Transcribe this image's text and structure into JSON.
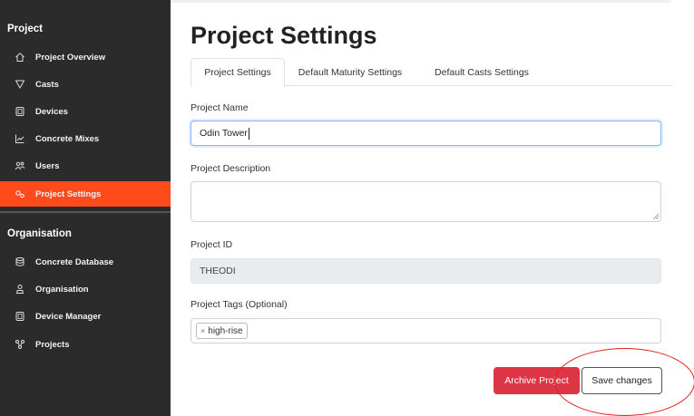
{
  "sidebar": {
    "project_section": "Project",
    "organisation_section": "Organisation",
    "project_items": [
      {
        "label": "Project Overview",
        "icon": "home-icon"
      },
      {
        "label": "Casts",
        "icon": "filter-icon"
      },
      {
        "label": "Devices",
        "icon": "device-icon"
      },
      {
        "label": "Concrete Mixes",
        "icon": "chart-line-icon"
      },
      {
        "label": "Users",
        "icon": "users-icon"
      },
      {
        "label": "Project Settings",
        "icon": "settings-icon",
        "active": true
      }
    ],
    "organisation_items": [
      {
        "label": "Concrete Database",
        "icon": "database-icon"
      },
      {
        "label": "Organisation",
        "icon": "organisation-icon"
      },
      {
        "label": "Device Manager",
        "icon": "device-icon"
      },
      {
        "label": "Projects",
        "icon": "projects-icon"
      }
    ]
  },
  "main": {
    "title": "Project Settings",
    "tabs": [
      {
        "label": "Project Settings",
        "active": true
      },
      {
        "label": "Default Maturity Settings"
      },
      {
        "label": "Default Casts Settings"
      }
    ],
    "fields": {
      "project_name_label": "Project Name",
      "project_name_value": "Odin Tower",
      "project_description_label": "Project Description",
      "project_description_value": "",
      "project_id_label": "Project ID",
      "project_id_value": "THEODI",
      "project_tags_label": "Project Tags (Optional)",
      "tags": [
        "high-rise"
      ],
      "tag_remove_glyph": "×"
    },
    "buttons": {
      "archive_label": "Archive Project",
      "save_label": "Save changes"
    }
  },
  "colors": {
    "sidebar_bg": "#2b2b2b",
    "active_accent": "#ff4a1c",
    "archive_button": "#dc3545",
    "annotation_circle": "#e0201c"
  }
}
